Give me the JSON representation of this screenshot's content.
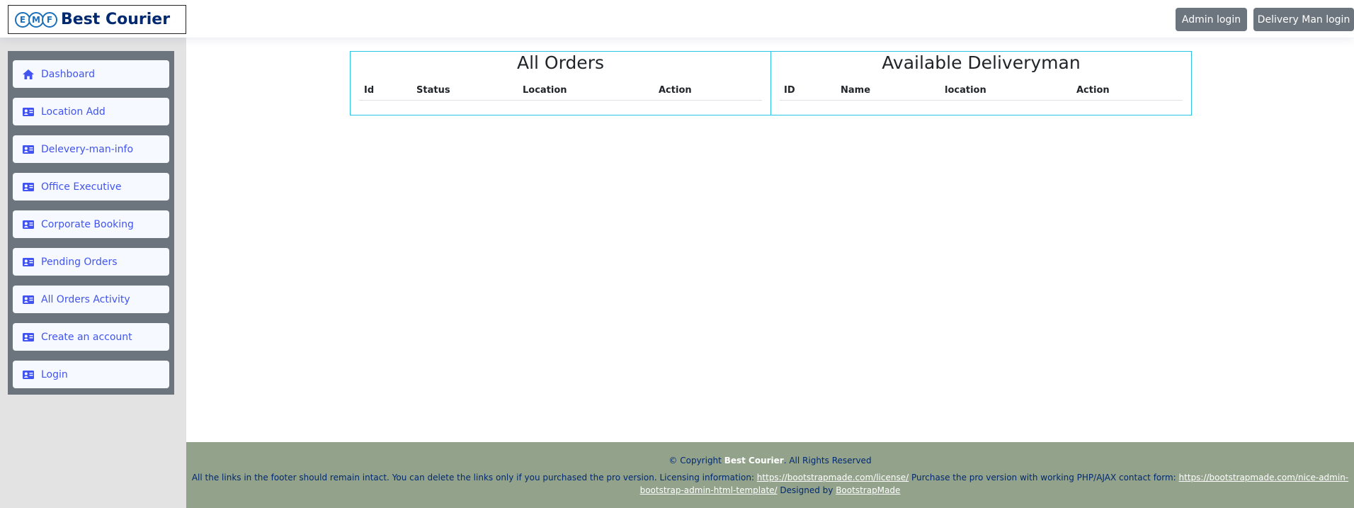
{
  "header": {
    "brand": "Best Courier",
    "logo_letters": [
      "E",
      "M",
      "F"
    ],
    "admin_login": "Admin login",
    "delivery_login": "Delivery Man login"
  },
  "sidebar": {
    "items": [
      {
        "label": "Dashboard",
        "icon": "house-icon"
      },
      {
        "label": "Location Add",
        "icon": "id-card-icon"
      },
      {
        "label": "Delevery-man-info",
        "icon": "id-card-icon"
      },
      {
        "label": "Office Executive",
        "icon": "id-card-icon"
      },
      {
        "label": "Corporate Booking",
        "icon": "id-card-icon"
      },
      {
        "label": "Pending Orders",
        "icon": "id-card-icon"
      },
      {
        "label": "All Orders Activity",
        "icon": "id-card-icon"
      },
      {
        "label": "Create an account",
        "icon": "id-card-icon"
      },
      {
        "label": "Login",
        "icon": "id-card-icon"
      }
    ]
  },
  "orders": {
    "title": "All Orders",
    "columns": [
      "Id",
      "Status",
      "Location",
      "Action"
    ]
  },
  "deliverymen": {
    "title": "Available Deliveryman",
    "columns": [
      "ID",
      "Name",
      "location",
      "Action"
    ]
  },
  "footer": {
    "copyright_prefix": "© Copyright ",
    "copyright_brand": "Best Courier",
    "copyright_suffix": ". All Rights Reserved",
    "credits_1": "All the links in the footer should remain intact. You can delete the links only if you purchased the pro version. Licensing information: ",
    "license_link": "https://bootstrapmade.com/license/",
    "credits_2": " Purchase the pro version with working PHP/AJAX contact form: ",
    "pro_link": "https://bootstrapmade.com/nice-admin-bootstrap-admin-html-template/",
    "credits_3": " Designed by ",
    "designer_link": "BootstrapMade"
  },
  "colors": {
    "accent": "#4154f1",
    "sidebar": "#6c757d",
    "panel_border": "#2ac3e8",
    "footer": "#93a28b"
  }
}
